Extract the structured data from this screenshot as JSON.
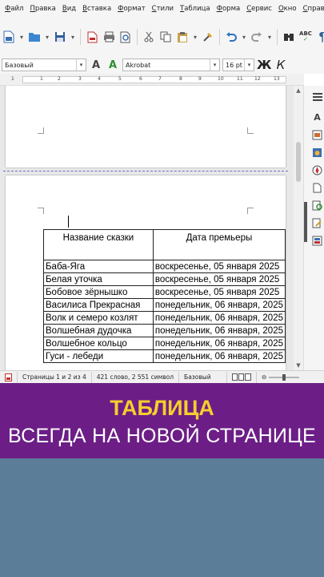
{
  "menu": [
    "Файл",
    "Правка",
    "Вид",
    "Вставка",
    "Формат",
    "Стили",
    "Таблица",
    "Форма",
    "Сервис",
    "Окно",
    "Справка"
  ],
  "formatting": {
    "paragraph_style": "Базовый",
    "font_name": "Akrobat",
    "font_size": "16 pt",
    "bold_label": "Ж",
    "italic_label": "К"
  },
  "ruler": {
    "numbers": [
      "1",
      "1",
      "2",
      "3",
      "4",
      "5",
      "6",
      "7",
      "8",
      "9",
      "10",
      "11",
      "12",
      "13"
    ]
  },
  "table": {
    "headers": [
      "Название сказки",
      "Дата премьеры"
    ],
    "rows": [
      [
        "Баба-Яга",
        "воскресенье, 05 января 2025"
      ],
      [
        "Белая уточка",
        "воскресенье, 05 января 2025"
      ],
      [
        "Бобовое зёрнышко",
        "воскресенье, 05 января 2025"
      ],
      [
        "Василиса Прекрасная",
        "понедельник, 06 января, 2025"
      ],
      [
        "Волк и семеро козлят",
        "понедельник, 06 января, 2025"
      ],
      [
        "Волшебная дудочка",
        "понедельник, 06 января, 2025"
      ],
      [
        "Волшебное кольцо",
        "понедельник, 06 января, 2025"
      ],
      [
        "Гуси - лебеди",
        "понедельник, 06 января, 2025"
      ]
    ]
  },
  "status": {
    "pages": "Страницы 1 и 2 из 4",
    "words": "421 слово, 2 551 символ",
    "page_style": "Базовый"
  },
  "banner": {
    "line1": "ТАБЛИЦА",
    "line2": "ВСЕГДА НА НОВОЙ СТРАНИЦЕ"
  },
  "colors": {
    "banner_bg": "#6c1e86",
    "banner_title": "#f6ce2d",
    "bottom_bg": "#5b7d97"
  },
  "icons": {
    "toolbar": [
      "new-document-icon",
      "open-folder-icon",
      "save-icon",
      "export-pdf-icon",
      "print-icon",
      "print-preview-icon",
      "cut-icon",
      "copy-icon",
      "paste-icon",
      "clone-formatting-icon",
      "undo-icon",
      "redo-icon",
      "find-replace-icon",
      "spellcheck-icon",
      "formatting-marks-icon"
    ],
    "sidebar": [
      "properties-icon",
      "styles-icon",
      "gallery-icon",
      "navigator-icon",
      "page-icon",
      "style-inspector-icon",
      "manage-changes-icon",
      "design-icon"
    ]
  }
}
